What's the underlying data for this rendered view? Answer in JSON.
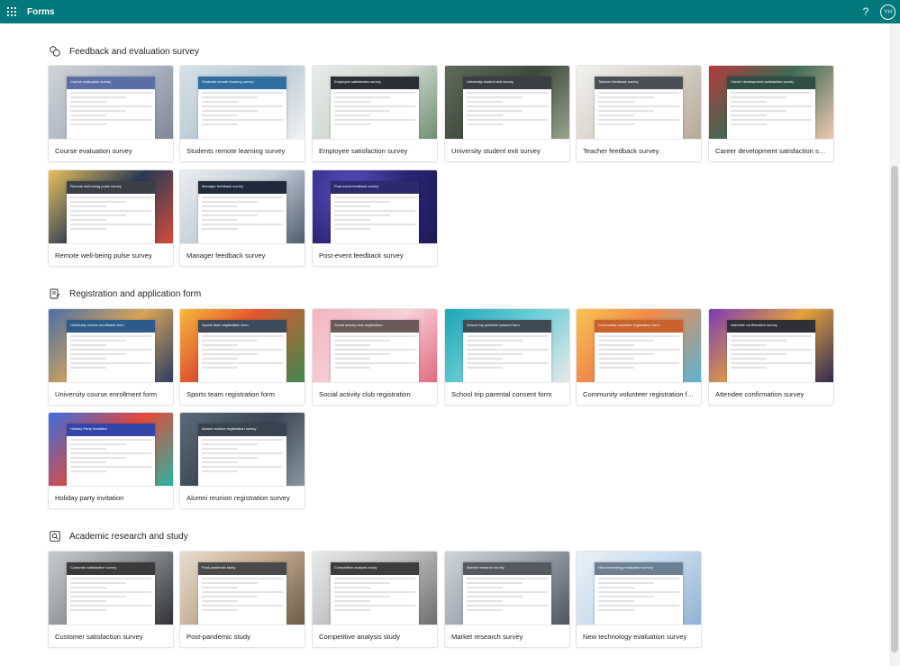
{
  "header": {
    "app_title": "Forms",
    "help_label": "?",
    "avatar_initials": "YH",
    "bar_color": "#03787c"
  },
  "sections": [
    {
      "title": "Feedback and evaluation survey",
      "icon": "feedback-icon",
      "templates": [
        {
          "label": "Course evaluation survey",
          "preview_title": "Course evaluation survey",
          "head_color": "#5b6fa6"
        },
        {
          "label": "Students remote learning survey",
          "preview_title": "Students remote learning survey",
          "head_color": "#2e6ea0"
        },
        {
          "label": "Employee satisfaction survey",
          "preview_title": "Employee satisfaction survey",
          "head_color": "#2b2f36"
        },
        {
          "label": "University student exit survey",
          "preview_title": "University student exit survey",
          "head_color": "#3a3f45"
        },
        {
          "label": "Teacher feedback survey",
          "preview_title": "Teacher feedback survey",
          "head_color": "#4a4f55"
        },
        {
          "label": "Career development satisfaction survey",
          "preview_title": "Career development satisfaction survey",
          "head_color": "#2f4e45"
        },
        {
          "label": "Remote well-being pulse survey",
          "preview_title": "Remote well-being pulse survey",
          "head_color": "#3b3f47"
        },
        {
          "label": "Manager feedback survey",
          "preview_title": "Manager feedback survey",
          "head_color": "#1f2a3a"
        },
        {
          "label": "Post-event feedback survey",
          "preview_title": "Post-event feedback survey",
          "head_color": "#2e2a6e"
        }
      ]
    },
    {
      "title": "Registration and application form",
      "icon": "form-icon",
      "templates": [
        {
          "label": "University course enrollment form",
          "preview_title": "University course enrollment form",
          "head_color": "#2d5b8a"
        },
        {
          "label": "Sports team registration form",
          "preview_title": "Sports team registration form",
          "head_color": "#3d4a5a"
        },
        {
          "label": "Social activity club registration",
          "preview_title": "Social activity club registration",
          "head_color": "#6a5a5a"
        },
        {
          "label": "School trip parental consent form",
          "preview_title": "School trip parental consent form",
          "head_color": "#3f4a55"
        },
        {
          "label": "Community volunteer registration form",
          "preview_title": "Community volunteer registration form",
          "head_color": "#c8632e"
        },
        {
          "label": "Attendee confirmation survey",
          "preview_title": "Attendee confirmation survey",
          "head_color": "#2f2f35"
        },
        {
          "label": "Holiday party invitation",
          "preview_title": "Holiday Party Invitation",
          "head_color": "#3245a8"
        },
        {
          "label": "Alumni reunion registration survey",
          "preview_title": "Alumni reunion registration survey",
          "head_color": "#3a4450"
        }
      ]
    },
    {
      "title": "Academic research and study",
      "icon": "research-icon",
      "templates": [
        {
          "label": "Customer satisfaction survey",
          "preview_title": "Customer satisfaction survey",
          "head_color": "#3a3a3a"
        },
        {
          "label": "Post-pandemic study",
          "preview_title": "Post-pandemic study",
          "head_color": "#4a4a4a"
        },
        {
          "label": "Competitive analysis study",
          "preview_title": "Competitive analysis study",
          "head_color": "#3d3d3d"
        },
        {
          "label": "Market research survey",
          "preview_title": "Market research survey",
          "head_color": "#555a60"
        },
        {
          "label": "New technology evaluation survey",
          "preview_title": "New technology evaluation survey",
          "head_color": "#6c7f93"
        }
      ]
    }
  ]
}
